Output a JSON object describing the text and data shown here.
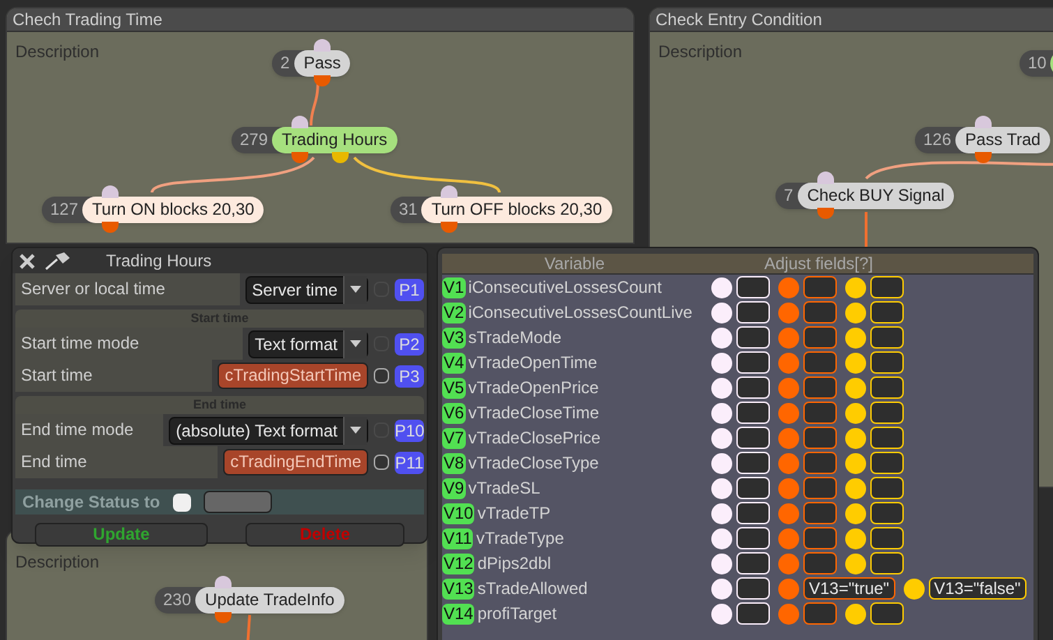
{
  "groups": [
    {
      "title": "Chech Trading Time",
      "description": "Description",
      "nodes": [
        {
          "number": "2",
          "label": "Pass",
          "color": "#d4d4d4",
          "kind": "step"
        },
        {
          "number": "279",
          "label": "Trading Hours",
          "color": "#a6e07e",
          "kind": "branch"
        },
        {
          "number": "127",
          "label": "Turn ON blocks 20,30",
          "color": "#fdeade",
          "kind": "step"
        },
        {
          "number": "31",
          "label": "Turn OFF blocks 20,30",
          "color": "#fdeade",
          "kind": "step"
        }
      ]
    },
    {
      "title": "Check Entry Condition",
      "description": "Description",
      "nodes": [
        {
          "number": "10",
          "color": "#a6e07e",
          "kind": "step"
        },
        {
          "number": "126",
          "label": "Pass Trad",
          "color": "#d4d4d4",
          "kind": "step"
        },
        {
          "number": "7",
          "label": "Check BUY Signal",
          "color": "#d4d4d4",
          "kind": "step"
        }
      ]
    },
    {
      "description": "Description",
      "nodes": [
        {
          "number": "230",
          "label": "Update TradeInfo",
          "color": "#d4d4d4",
          "kind": "step"
        }
      ]
    }
  ],
  "block_dialog": {
    "title": "Trading Hours",
    "rows": [
      {
        "kind": "select",
        "label": "Server or local time",
        "value": "Server time",
        "checked": false,
        "disabled": true,
        "tag": "P1"
      },
      {
        "kind": "section",
        "label": "Start time"
      },
      {
        "kind": "select",
        "label": "Start time mode",
        "value": "Text format",
        "checked": false,
        "disabled": true,
        "tag": "P2"
      },
      {
        "kind": "variable",
        "label": "Start time",
        "value": "cTradingStartTime",
        "checked": false,
        "disabled": false,
        "tag": "P3"
      },
      {
        "kind": "section",
        "label": "End time"
      },
      {
        "kind": "select",
        "label": "End time mode",
        "value": "(absolute) Text format",
        "checked": false,
        "disabled": true,
        "tag": "P10"
      },
      {
        "kind": "variable",
        "label": "End time",
        "value": "cTradingEndTime",
        "checked": false,
        "disabled": false,
        "tag": "P11"
      }
    ],
    "status": {
      "label": "Change Status to",
      "checked": false
    },
    "buttons": [
      {
        "label": "Update",
        "color": "#2fa52f"
      },
      {
        "label": "Delete",
        "color": "#c00000"
      }
    ]
  },
  "variables_dialog": {
    "columns": [
      "Variable",
      "Adjust fields[?]"
    ],
    "ports": [
      {
        "color": "#fbeefb"
      },
      {
        "color": "#ff6600"
      },
      {
        "color": "#ffcc00"
      }
    ],
    "rows": [
      {
        "tag": "V1",
        "name": "iConsecutiveLossesCount"
      },
      {
        "tag": "V2",
        "name": "iConsecutiveLossesCountLive"
      },
      {
        "tag": "V3",
        "name": "sTradeMode"
      },
      {
        "tag": "V4",
        "name": "vTradeOpenTime"
      },
      {
        "tag": "V5",
        "name": "vTradeOpenPrice"
      },
      {
        "tag": "V6",
        "name": "vTradeCloseTime"
      },
      {
        "tag": "V7",
        "name": "vTradeClosePrice"
      },
      {
        "tag": "V8",
        "name": "vTradeCloseType"
      },
      {
        "tag": "V9",
        "name": "vTradeSL"
      },
      {
        "tag": "V10",
        "name": "vTradeTP"
      },
      {
        "tag": "V11",
        "name": "vTradeType"
      },
      {
        "tag": "V12",
        "name": "dPips2dbl"
      },
      {
        "tag": "V13",
        "name": "sTradeAllowed",
        "output_1_value": "V13=\"true\"",
        "output_2_value": "V13=\"false\""
      },
      {
        "tag": "V14",
        "name": "profiTarget"
      }
    ]
  }
}
